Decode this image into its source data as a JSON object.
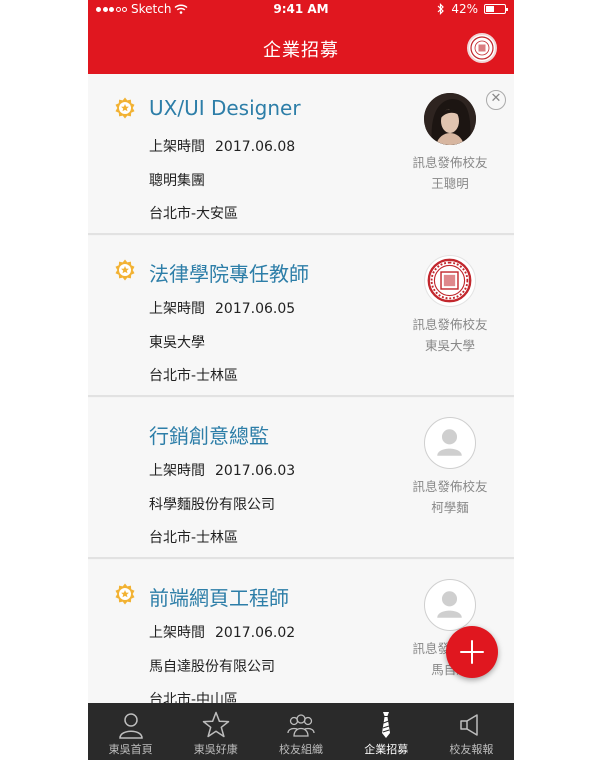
{
  "status_bar": {
    "carrier": "Sketch",
    "time": "9:41 AM",
    "battery": "42%",
    "battery_level": 0.42
  },
  "nav": {
    "title": "企業招募",
    "logo_icon": "school-seal"
  },
  "jobs": [
    {
      "title": "UX/UI Designer",
      "favorited": true,
      "posted_label": "上架時間",
      "posted_date": "2017.06.08",
      "company": "聰明集團",
      "location": "台北市-大安區",
      "poster_label": "訊息發佈校友",
      "poster_name": "王聰明",
      "avatar": "photo",
      "closable": true
    },
    {
      "title": "法律學院專任教師",
      "favorited": true,
      "posted_label": "上架時間",
      "posted_date": "2017.06.05",
      "company": "東吳大學",
      "location": "台北市-士林區",
      "poster_label": "訊息發佈校友",
      "poster_name": "東吳大學",
      "avatar": "seal"
    },
    {
      "title": "行銷創意總監",
      "favorited": false,
      "posted_label": "上架時間",
      "posted_date": "2017.06.03",
      "company": "科學麵股份有限公司",
      "location": "台北市-士林區",
      "poster_label": "訊息發佈校友",
      "poster_name": "柯學麵",
      "avatar": "placeholder"
    },
    {
      "title": "前端網頁工程師",
      "favorited": true,
      "posted_label": "上架時間",
      "posted_date": "2017.06.02",
      "company": "馬自達股份有限公司",
      "location": "台北市-中山區",
      "poster_label": "訊息發佈校友",
      "poster_name": "馬自達",
      "avatar": "placeholder"
    }
  ],
  "tabs": [
    {
      "label": "東吳首頁",
      "icon": "person-icon",
      "active": false
    },
    {
      "label": "東吳好康",
      "icon": "star-icon",
      "active": false
    },
    {
      "label": "校友組織",
      "icon": "group-icon",
      "active": false
    },
    {
      "label": "企業招募",
      "icon": "tie-icon",
      "active": true
    },
    {
      "label": "校友報報",
      "icon": "megaphone-icon",
      "active": false
    }
  ],
  "fab": {
    "icon": "plus-icon"
  },
  "colors": {
    "brand_red": "#e0171f",
    "title_blue": "#2d7ea8",
    "star_gold": "#f2b233",
    "tabbar": "#2a2a2a"
  }
}
